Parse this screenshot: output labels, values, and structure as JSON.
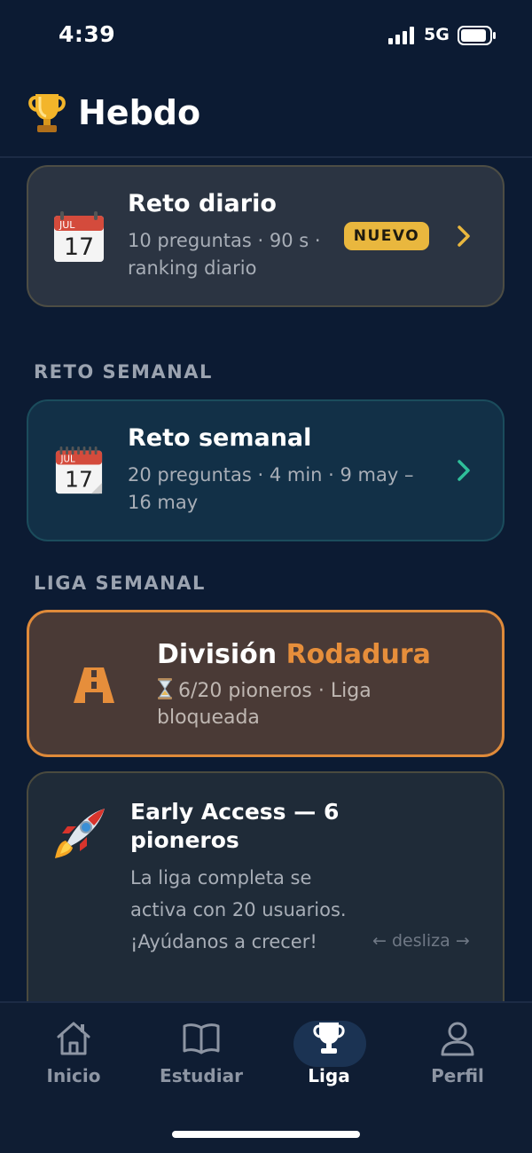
{
  "status_bar": {
    "time": "4:39",
    "network": "5G",
    "icons": [
      "signal-icon",
      "battery-icon"
    ]
  },
  "header": {
    "title": "Hebdo",
    "icon": "trophy-icon"
  },
  "daily_challenge": {
    "title": "Reto diario",
    "subtitle": "10 preguntas · 90 s · ranking diario",
    "badge": "NUEVO",
    "calendar_month": "JUL",
    "calendar_day": "17"
  },
  "weekly_section": {
    "label": "RETO SEMANAL",
    "card": {
      "title": "Reto semanal",
      "subtitle": "20 preguntas · 4 min · 9 may – 16 may",
      "calendar_month": "JUL",
      "calendar_day": "17"
    }
  },
  "league_section": {
    "label": "LIGA SEMANAL",
    "card": {
      "title_prefix": "División ",
      "title_accent": "Rodadura",
      "subtitle": "6/20 pioneros · Liga bloqueada"
    }
  },
  "early_access": {
    "title": "Early Access — 6 pioneros",
    "body": "La liga completa se activa con 20 usuarios. ¡Ayúdanos a crecer!",
    "swipe_hint": "← desliza →"
  },
  "bottom_nav": {
    "items": [
      {
        "label": "Inicio",
        "icon": "home-icon"
      },
      {
        "label": "Estudiar",
        "icon": "book-icon"
      },
      {
        "label": "Liga",
        "icon": "trophy-icon",
        "active": true
      },
      {
        "label": "Perfil",
        "icon": "user-icon"
      }
    ]
  },
  "colors": {
    "background": "#0c1b33",
    "badge": "#e9b73e",
    "league_accent": "#e68e3b",
    "weekly_chevron": "#2fbf9a",
    "daily_chevron": "#e9b73e"
  }
}
